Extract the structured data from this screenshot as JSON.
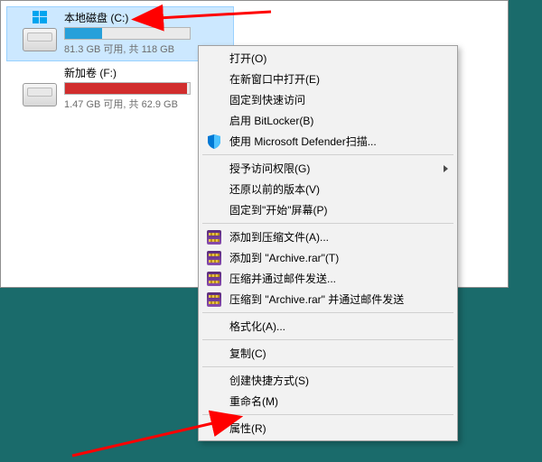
{
  "drives": {
    "c": {
      "name": "本地磁盘 (C:)",
      "stat": "81.3 GB 可用, 共 118 GB"
    },
    "f": {
      "name": "新加卷 (F:)",
      "stat": "1.47 GB 可用, 共 62.9 GB"
    }
  },
  "menu": {
    "open": "打开(O)",
    "open_new_window": "在新窗口中打开(E)",
    "pin_quick_access": "固定到快速访问",
    "bitlocker": "启用 BitLocker(B)",
    "defender": "使用 Microsoft Defender扫描...",
    "grant_access": "授予访问权限(G)",
    "restore_prev": "还原以前的版本(V)",
    "pin_start": "固定到\"开始\"屏幕(P)",
    "add_archive": "添加到压缩文件(A)...",
    "add_archive_rar": "添加到 \"Archive.rar\"(T)",
    "compress_mail": "压缩并通过邮件发送...",
    "compress_rar_mail": "压缩到 \"Archive.rar\" 并通过邮件发送",
    "format": "格式化(A)...",
    "copy": "复制(C)",
    "create_shortcut": "创建快捷方式(S)",
    "rename": "重命名(M)",
    "properties": "属性(R)"
  }
}
